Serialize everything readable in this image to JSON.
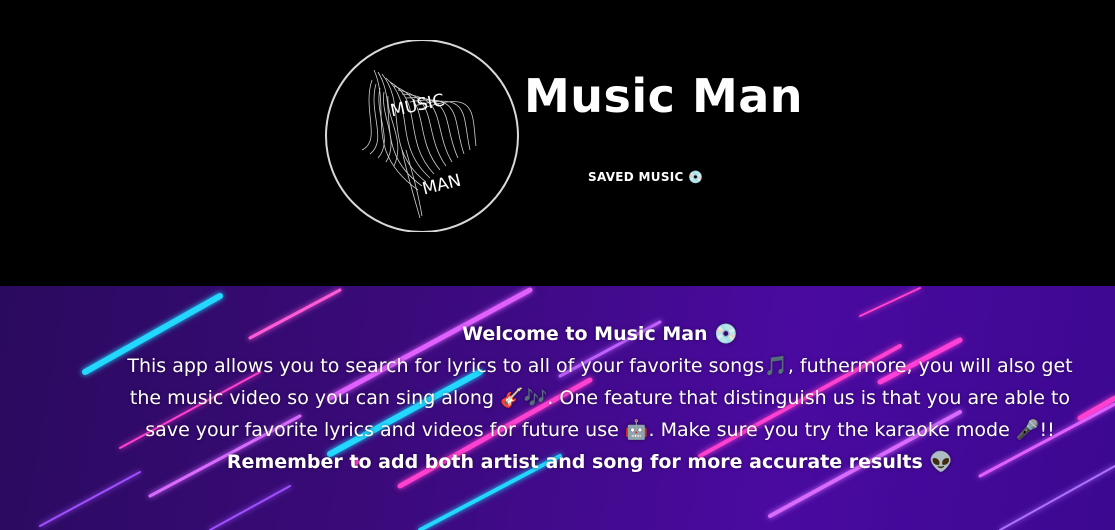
{
  "header": {
    "logo_text_top": "MUSIC",
    "logo_text_bottom": "MAN",
    "title": "Music Man",
    "saved_link": "SAVED MUSIC 💿"
  },
  "intro": {
    "welcome": "Welcome to Music Man 💿",
    "body": "This app allows you to search for lyrics to all of your favorite songs🎵, futhermore, you will also get the music video so you can sing along 🎸🎶. One feature that distinguish us is that you are able to save your favorite lyrics and videos for future use 🤖. Make sure you try the karaoke mode 🎤!!",
    "reminder": "Remember to add both artist and song for more accurate results 👽"
  },
  "colors": {
    "header_bg": "#000000",
    "hero_gradient_start": "#2a0a5e",
    "hero_gradient_end": "#4a0aa0",
    "streak_cyan": "#20d8ff",
    "streak_pink": "#ff3fd0",
    "streak_violet": "#b070ff"
  }
}
